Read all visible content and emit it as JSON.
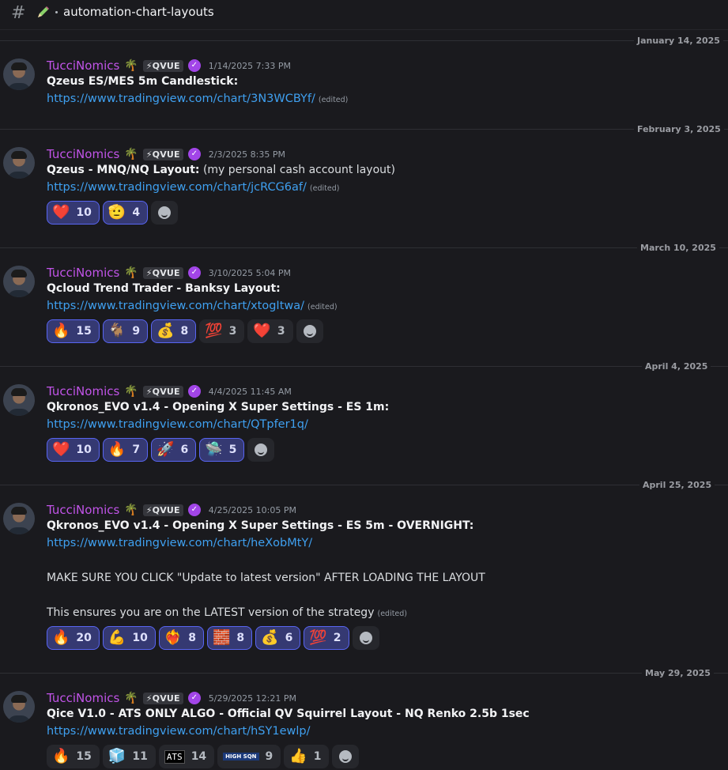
{
  "channel": {
    "name": "automation-chart-layouts",
    "hash_icon": "#",
    "icon": "pencil-icon"
  },
  "author": {
    "name": "TucciNomics",
    "emoji": "🌴",
    "badge": "⚡QVUE"
  },
  "messages": [
    {
      "date_divider": "January 14, 2025",
      "timestamp": "1/14/2025 7:33 PM",
      "title": "Qzeus ES/MES 5m Candlestick:",
      "link": "https://www.tradingview.com/chart/3N3WCBYf/",
      "edited": "(edited)"
    },
    {
      "date_divider": "February 3, 2025",
      "timestamp": "2/3/2025 8:35 PM",
      "title": "Qzeus - MNQ/NQ Layout:",
      "title_suffix": " (my personal cash account layout)",
      "link": "https://www.tradingview.com/chart/jcRCG6af/",
      "edited": "(edited)",
      "reactions": [
        {
          "emoji": "❤️",
          "count": "10"
        },
        {
          "emoji": "🫡",
          "count": "4"
        }
      ]
    },
    {
      "date_divider": "March 10, 2025",
      "timestamp": "3/10/2025 5:04 PM",
      "title": "Qcloud Trend Trader - Banksy Layout:",
      "link": "https://www.tradingview.com/chart/xtogItwa/",
      "edited": "(edited)",
      "reactions": [
        {
          "emoji": "🔥",
          "count": "15"
        },
        {
          "emoji": "🐐",
          "count": "9"
        },
        {
          "emoji": "💰",
          "count": "8"
        },
        {
          "emoji": "💯",
          "count": "3"
        },
        {
          "emoji": "❤️",
          "count": "3"
        }
      ]
    },
    {
      "date_divider": "April 4, 2025",
      "timestamp": "4/4/2025 11:45 AM",
      "title": "Qkronos_EVO v1.4 - Opening X Super Settings - ES 1m:",
      "link": "https://www.tradingview.com/chart/QTpfer1q/",
      "reactions": [
        {
          "emoji": "❤️",
          "count": "10"
        },
        {
          "emoji": "🔥",
          "count": "7"
        },
        {
          "emoji": "🚀",
          "count": "6"
        },
        {
          "emoji": "🛸",
          "count": "5"
        }
      ]
    },
    {
      "date_divider": "April 25, 2025",
      "timestamp": "4/25/2025 10:05 PM",
      "title": "Qkronos_EVO v1.4 - Opening X Super Settings - ES 5m - OVERNIGHT:",
      "link": "https://www.tradingview.com/chart/heXobMtY/",
      "body1": "MAKE SURE YOU CLICK \"Update to latest version\" AFTER LOADING THE LAYOUT",
      "body2": "This ensures you are on the LATEST version of the strategy",
      "edited": "(edited)",
      "reactions": [
        {
          "emoji": "🔥",
          "count": "20"
        },
        {
          "emoji": "💪",
          "count": "10"
        },
        {
          "emoji": "❤️‍🔥",
          "count": "8"
        },
        {
          "emoji": "🧱",
          "count": "8"
        },
        {
          "emoji": "💰",
          "count": "6"
        },
        {
          "emoji": "💯",
          "count": "2"
        }
      ]
    },
    {
      "date_divider": "May 29, 2025",
      "timestamp": "5/29/2025 12:21 PM",
      "title": "Qice V1.0 - ATS ONLY ALGO - Official QV Squirrel Layout - NQ Renko 2.5b 1sec",
      "link": "https://www.tradingview.com/chart/hSY1ewlp/",
      "reactions": [
        {
          "emoji": "🔥",
          "count": "15"
        },
        {
          "emoji": "🧊",
          "count": "11"
        },
        {
          "emoji": "ATS",
          "count": "14"
        },
        {
          "emoji": "HIGH SQN",
          "count": "9"
        },
        {
          "emoji": "👍",
          "count": "1"
        }
      ]
    }
  ]
}
